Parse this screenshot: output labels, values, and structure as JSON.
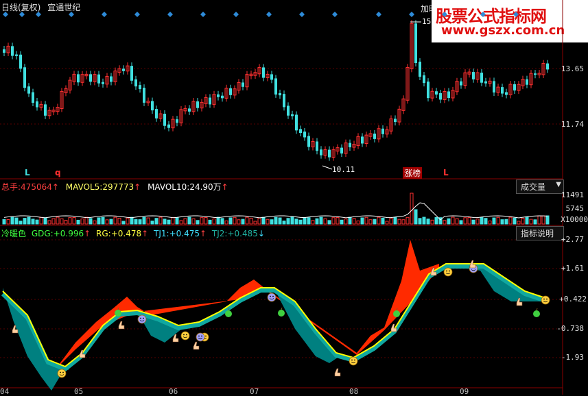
{
  "header": {
    "title": "日线(复权)",
    "stock_name": "宜通世纪",
    "partial_menu": "加时"
  },
  "watermark": {
    "main": "股票公式指标网",
    "url": "www.gszx.com.cn"
  },
  "price_panel": {
    "high_label": "15.",
    "low_label": "10.11",
    "right_axis": [
      "13.65",
      "11.74"
    ],
    "markers": {
      "l1": "L",
      "q": "q",
      "zhangbang": "涨榜",
      "l2": "L"
    }
  },
  "volume_panel": {
    "total_label": "总手:",
    "total_value": "475064",
    "mavol5_label": "MAVOL5:",
    "mavol5_value": "297773",
    "mavol10_label": "MAVOL10:",
    "mavol10_value": "24.90万",
    "button": "成交量",
    "right_axis": [
      "11491",
      "5745",
      "X10000"
    ]
  },
  "indicator_panel": {
    "name": "冷暖色",
    "gdg_label": "GDG:",
    "gdg_value": "+0.996",
    "rg_label": "RG:",
    "rg_value": "+0.478",
    "tj1_label": "TJ1:",
    "tj1_value": "+0.475",
    "tj2_label": "TJ2:",
    "tj2_value": "+0.485",
    "button": "指标说明",
    "right_axis": [
      "+2.77",
      "+1.61",
      "+0.422",
      "-0.738",
      "-1.93"
    ]
  },
  "x_axis": [
    "04",
    "05",
    "06",
    "07",
    "08",
    "09"
  ],
  "colors": {
    "up": "#ff3030",
    "down": "#40e0e0",
    "red_fill": "#ff2a00",
    "teal_fill": "#008080",
    "yellow_line": "#ffff00",
    "diamond": "#2e8bd8"
  }
}
